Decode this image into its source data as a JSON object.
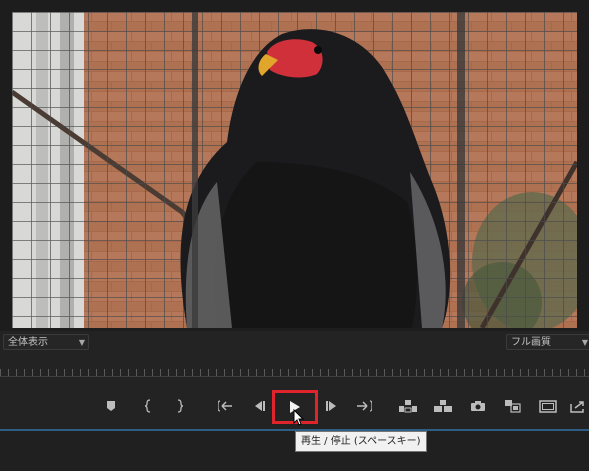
{
  "settings": {
    "zoom_select": "全体表示",
    "quality_select": "フル画質"
  },
  "controls": [
    {
      "id": "add-marker",
      "icon": "marker-icon"
    },
    {
      "id": "mark-in",
      "icon": "mark-in-icon"
    },
    {
      "id": "mark-out",
      "icon": "mark-out-icon"
    },
    {
      "id": "go-to-in",
      "icon": "go-to-in-icon"
    },
    {
      "id": "step-back",
      "icon": "step-back-icon"
    },
    {
      "id": "play-stop",
      "icon": "play-icon"
    },
    {
      "id": "step-forward",
      "icon": "step-forward-icon"
    },
    {
      "id": "go-to-out",
      "icon": "go-to-out-icon"
    },
    {
      "id": "lift",
      "icon": "lift-icon"
    },
    {
      "id": "extract",
      "icon": "extract-icon"
    },
    {
      "id": "export-frame",
      "icon": "camera-icon"
    },
    {
      "id": "compare-view",
      "icon": "compare-view-icon"
    },
    {
      "id": "safe-margins",
      "icon": "safe-margins-icon"
    },
    {
      "id": "export",
      "icon": "export-icon"
    }
  ],
  "tooltip": "再生 / 停止 (スペースキー)",
  "colors": {
    "panel_bg": "#232323",
    "highlight": "#e0242b",
    "accent_line": "#2e5e86",
    "tooltip_bg": "#f1f1f1"
  }
}
